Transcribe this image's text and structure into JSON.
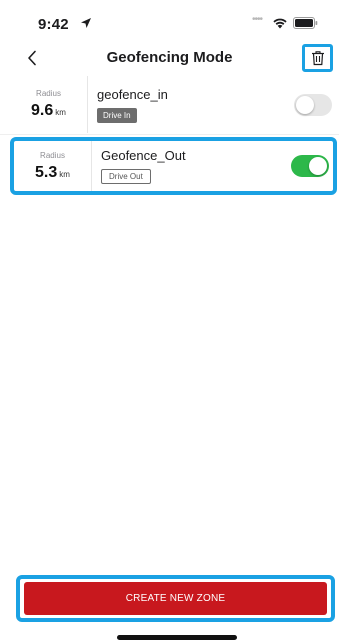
{
  "status_bar": {
    "time": "9:42",
    "icons": [
      "location-arrow-icon",
      "signal-dots-icon",
      "wifi-icon",
      "battery-icon"
    ]
  },
  "nav": {
    "title": "Geofencing Mode",
    "back_icon": "chevron-left-icon",
    "delete_icon": "trash-icon"
  },
  "zones": [
    {
      "radius_label": "Radius",
      "radius_value": "9.6",
      "radius_unit": "km",
      "name": "geofence_in",
      "tag": "Drive In",
      "enabled": false
    },
    {
      "radius_label": "Radius",
      "radius_value": "5.3",
      "radius_unit": "km",
      "name": "Geofence_Out",
      "tag": "Drive Out",
      "enabled": true
    }
  ],
  "create_button_label": "CREATE NEW ZONE",
  "colors": {
    "highlight": "#1aa1e3",
    "toggle_on": "#2db84a",
    "primary_button": "#c8181e",
    "tag_in_bg": "#6d6d6d"
  }
}
